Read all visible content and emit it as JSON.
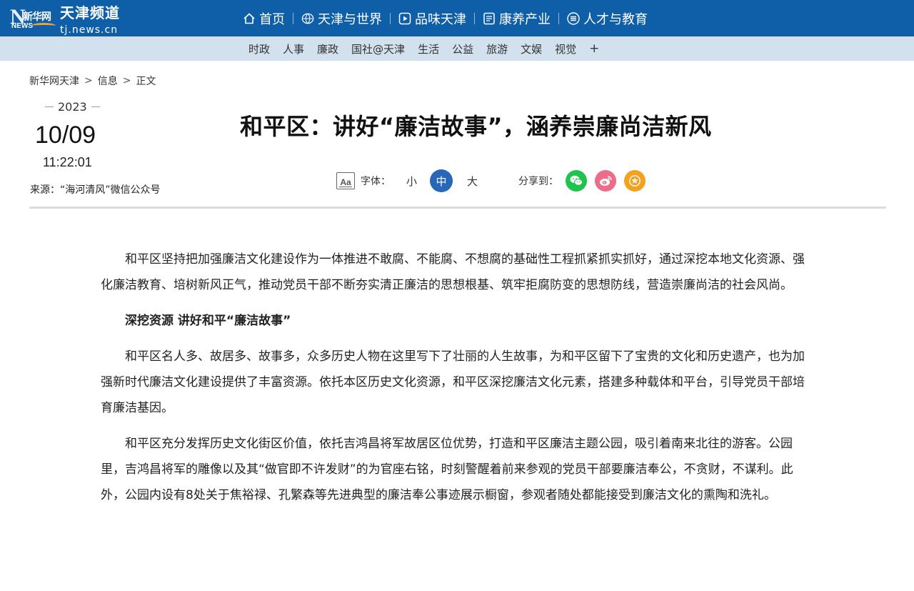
{
  "header": {
    "logo": {
      "badge_cn": "新华网",
      "badge_en": "NEWS",
      "site_cn": "天津频道",
      "site_en": "tj.news.cn"
    },
    "nav": [
      {
        "label": "首页",
        "icon": "home-icon"
      },
      {
        "label": "天津与世界",
        "icon": "globe-icon"
      },
      {
        "label": "品味天津",
        "icon": "play-icon"
      },
      {
        "label": "康养产业",
        "icon": "document-icon"
      },
      {
        "label": "人才与教育",
        "icon": "stack-icon"
      }
    ],
    "subnav": [
      "时政",
      "人事",
      "廉政",
      "国社@天津",
      "生活",
      "公益",
      "旅游",
      "文娱",
      "视觉"
    ],
    "subnav_more": "+"
  },
  "breadcrumb": [
    "新华网天津",
    "信息",
    "正文"
  ],
  "breadcrumb_sep": ">",
  "meta": {
    "year": "2023",
    "month_day": "10/09",
    "time": "11:22:01",
    "source": "来源：“海河清风”微信公众号"
  },
  "article": {
    "title": "和平区：讲好“廉洁故事”，涵养崇廉尚洁新风",
    "paragraphs": [
      {
        "type": "p",
        "text": "和平区坚持把加强廉洁文化建设作为一体推进不敢腐、不能腐、不想腐的基础性工程抓紧抓实抓好，通过深挖本地文化资源、强化廉洁教育、培树新风正气，推动党员干部不断夯实清正廉洁的思想根基、筑牢拒腐防变的思想防线，营造崇廉尚洁的社会风尚。"
      },
      {
        "type": "subhead",
        "text": "深挖资源 讲好和平“廉洁故事”"
      },
      {
        "type": "p",
        "text": "和平区名人多、故居多、故事多，众多历史人物在这里写下了壮丽的人生故事，为和平区留下了宝贵的文化和历史遗产，也为加强新时代廉洁文化建设提供了丰富资源。依托本区历史文化资源，和平区深挖廉洁文化元素，搭建多种载体和平台，引导党员干部培育廉洁基因。"
      },
      {
        "type": "p",
        "text": "和平区充分发挥历史文化街区价值，依托吉鸿昌将军故居区位优势，打造和平区廉洁主题公园，吸引着南来北往的游客。公园里，吉鸿昌将军的雕像以及其“做官即不许发财”的为官座右铭，时刻警醒着前来参观的党员干部要廉洁奉公，不贪财，不谋利。此外，公园内设有8处关于焦裕禄、孔繁森等先进典型的廉洁奉公事迹展示橱窗，参观者随处都能接受到廉洁文化的熏陶和洗礼。"
      }
    ]
  },
  "tools": {
    "font_icon": "Aa",
    "font_label": "字体：",
    "sizes": {
      "small": "小",
      "medium": "中",
      "large": "大"
    },
    "share_label": "分享到："
  },
  "colors": {
    "header_bg": "#0f5fa8",
    "subnav_bg": "#d3e1ee",
    "accent": "#2866b8",
    "wechat": "#1fc34e",
    "weibo": "#ec6d8a",
    "favorite": "#f3a11f"
  }
}
